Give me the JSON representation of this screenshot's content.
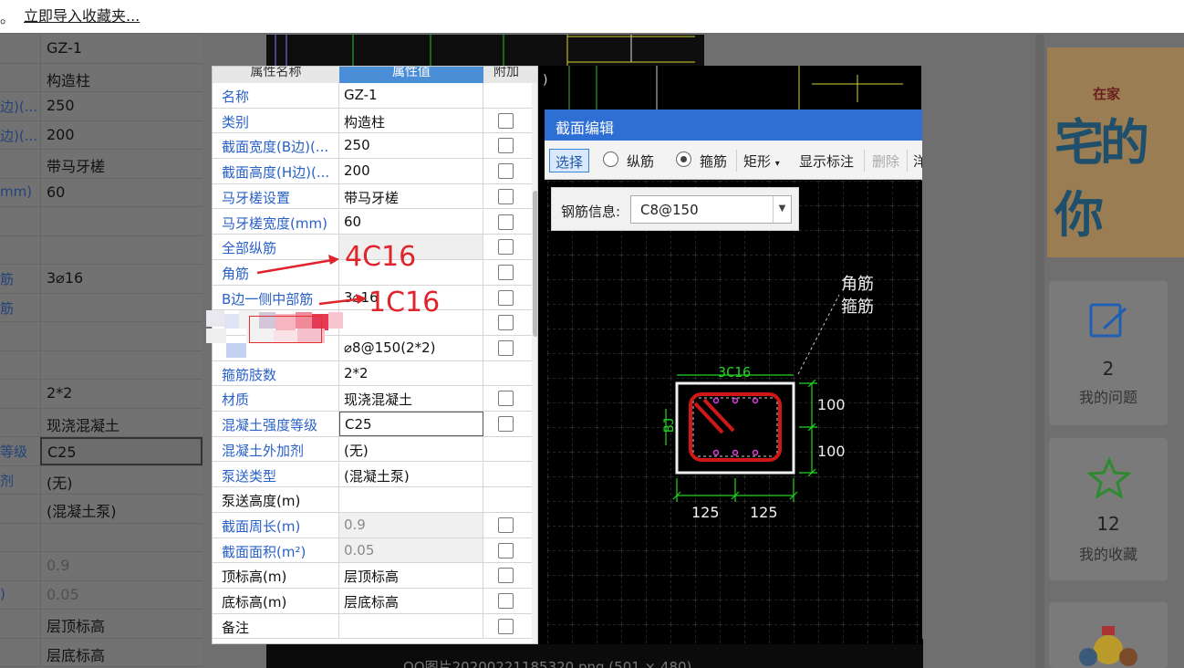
{
  "topbar": {
    "dots": "。",
    "import_link": "立即导入收藏夹..."
  },
  "bg_grid": {
    "rows": [
      {
        "key": "",
        "value": "GZ-1"
      },
      {
        "key": "",
        "value": "构造柱"
      },
      {
        "key": "边)(...",
        "value": "250"
      },
      {
        "key": "边)(...",
        "value": "200"
      },
      {
        "key": "",
        "value": "带马牙槎"
      },
      {
        "key": "mm)",
        "value": "60"
      },
      {
        "key": "",
        "value": ""
      },
      {
        "key": "",
        "value": ""
      },
      {
        "key": "筋",
        "value": "3⌀16"
      },
      {
        "key": "筋",
        "value": ""
      },
      {
        "key": "",
        "value": ""
      },
      {
        "key": "",
        "value": ""
      },
      {
        "key": "",
        "value": "2*2"
      },
      {
        "key": "",
        "value": "现浇混凝土"
      },
      {
        "key": "等级",
        "value": "C25"
      },
      {
        "key": "剂",
        "value": "(无)"
      },
      {
        "key": "",
        "value": "(混凝土泵)"
      },
      {
        "key": "",
        "value": ""
      },
      {
        "key": "",
        "value": "0.9"
      },
      {
        "key": ")",
        "value": "0.05"
      },
      {
        "key": "",
        "value": "层顶标高"
      },
      {
        "key": "",
        "value": "层底标高"
      }
    ]
  },
  "bg_caption": "QQ图片20200221185320.png (501 × 480)",
  "sidebar": {
    "banner_big": "宅的你",
    "banner_small": "在家",
    "questions": {
      "count": "2",
      "label": "我的问题"
    },
    "favorites": {
      "count": "12",
      "label": "我的收藏"
    }
  },
  "prop_table": {
    "headers": {
      "name": "属性名称",
      "value": "属性值",
      "extra": "附加"
    },
    "rows": [
      {
        "key": "名称",
        "value": "GZ-1",
        "checkbox": false
      },
      {
        "key": "类别",
        "value": "构造柱",
        "checkbox": true
      },
      {
        "key": "截面宽度(B边)(...",
        "value": "250",
        "checkbox": true
      },
      {
        "key": "截面高度(H边)(...",
        "value": "200",
        "checkbox": true
      },
      {
        "key": "马牙槎设置",
        "value": "带马牙槎",
        "checkbox": true
      },
      {
        "key": "马牙槎宽度(mm)",
        "value": "60",
        "checkbox": true
      },
      {
        "key": "全部纵筋",
        "value": "",
        "checkbox": true
      },
      {
        "key": "角筋",
        "value": "",
        "checkbox": true
      },
      {
        "key": "B边一侧中部筋",
        "value": "3⌀16",
        "checkbox": true
      },
      {
        "key": "",
        "value": "",
        "checkbox": true
      },
      {
        "key": "",
        "value": "⌀8@150(2*2)",
        "checkbox": true
      },
      {
        "key": "箍筋肢数",
        "value": "2*2",
        "checkbox": false
      },
      {
        "key": "材质",
        "value": "现浇混凝土",
        "checkbox": true
      },
      {
        "key": "混凝土强度等级",
        "value": "C25",
        "checkbox": true
      },
      {
        "key": "混凝土外加剂",
        "value": "(无)",
        "checkbox": false
      },
      {
        "key": "泵送类型",
        "value": "(混凝土泵)",
        "checkbox": false
      },
      {
        "key": "泵送高度(m)",
        "value": "",
        "checkbox": false
      },
      {
        "key": "截面周长(m)",
        "value": "0.9",
        "checkbox": true
      },
      {
        "key": "截面面积(m²)",
        "value": "0.05",
        "checkbox": true
      },
      {
        "key": "顶标高(m)",
        "value": "层顶标高",
        "checkbox": true
      },
      {
        "key": "底标高(m)",
        "value": "层底标高",
        "checkbox": true
      },
      {
        "key": "备注",
        "value": "",
        "checkbox": true
      }
    ]
  },
  "annotations": {
    "a1": "4C16",
    "a2": "1C16"
  },
  "section_editor": {
    "title": "截面编辑",
    "toolbar": {
      "select": "选择",
      "longitudinal": "纵筋",
      "stirrup": "箍筋",
      "rect": "矩形",
      "show_label": "显示标注",
      "delete": "删除",
      "more": "洋"
    },
    "rebar_info": {
      "label": "钢筋信息:",
      "value": "C8@150"
    },
    "drawing": {
      "top_label": "3C16",
      "side_label": "BJ",
      "leader_1": "角筋",
      "leader_2": "箍筋",
      "dim_h1": "100",
      "dim_h2": "100",
      "dim_b1": "125",
      "dim_b2": "125"
    }
  },
  "colors": {
    "accent_blue": "#2e6fd6",
    "annotation_red": "#e0242b",
    "cad_green": "#22d422",
    "cad_magenta": "#e040e0",
    "stirrup_red": "#d01818"
  }
}
